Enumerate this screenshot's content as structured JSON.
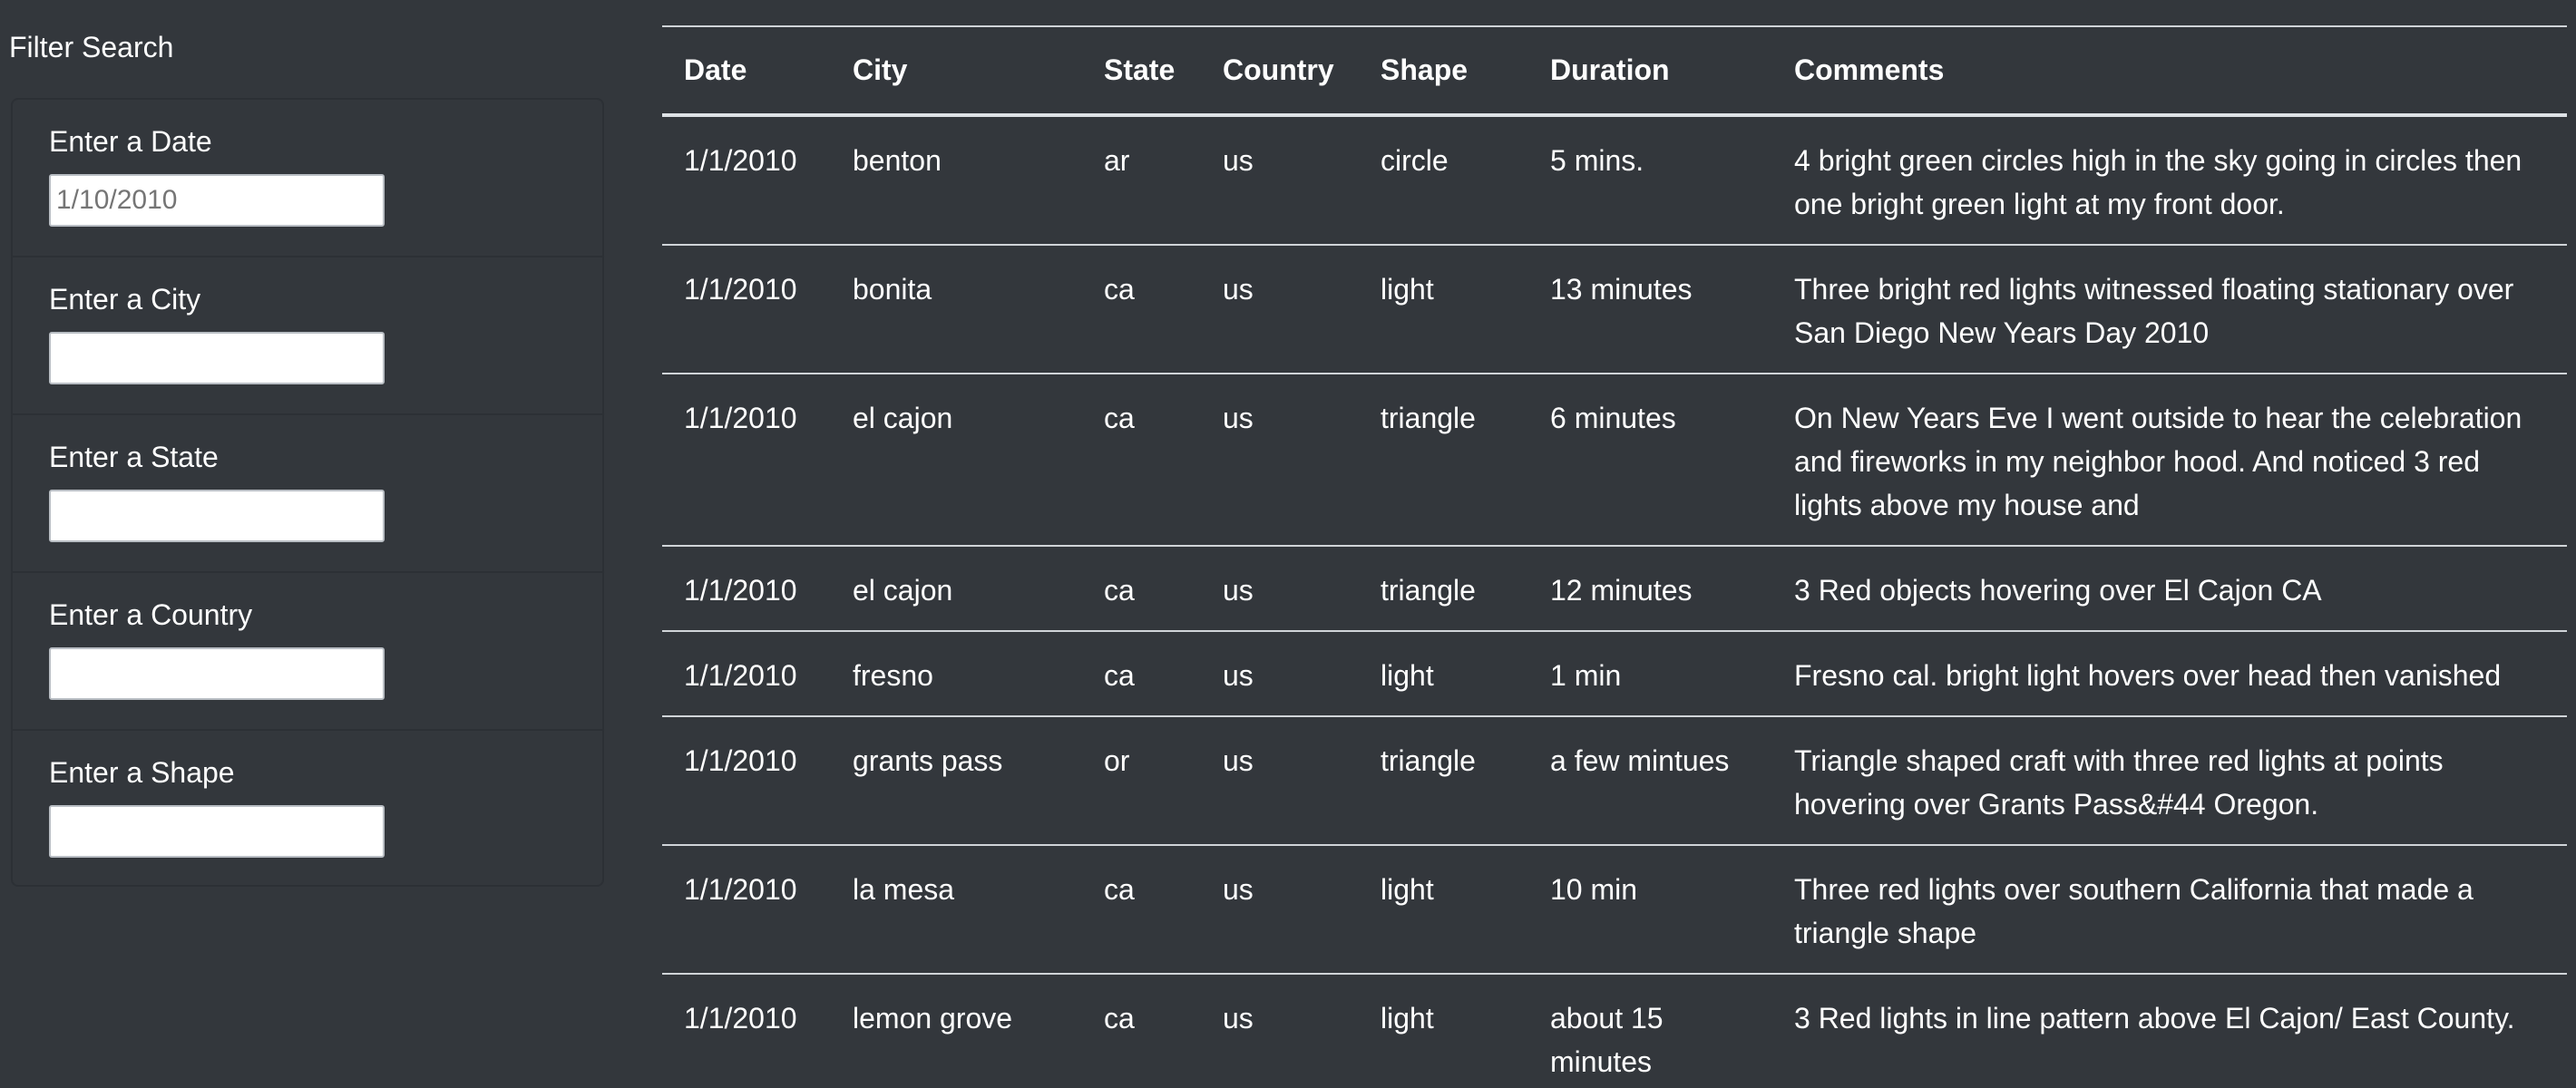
{
  "filter": {
    "title": "Filter Search",
    "fields": [
      {
        "label": "Enter a Date",
        "placeholder": "1/10/2010"
      },
      {
        "label": "Enter a City",
        "placeholder": ""
      },
      {
        "label": "Enter a State",
        "placeholder": ""
      },
      {
        "label": "Enter a Country",
        "placeholder": ""
      },
      {
        "label": "Enter a Shape",
        "placeholder": ""
      }
    ]
  },
  "table": {
    "headers": [
      "Date",
      "City",
      "State",
      "Country",
      "Shape",
      "Duration",
      "Comments"
    ],
    "rows": [
      [
        "1/1/2010",
        "benton",
        "ar",
        "us",
        "circle",
        "5 mins.",
        "4 bright green circles high in the sky going in circles then one bright green light at my front door."
      ],
      [
        "1/1/2010",
        "bonita",
        "ca",
        "us",
        "light",
        "13 minutes",
        "Three bright red lights witnessed floating stationary over San Diego New Years Day 2010"
      ],
      [
        "1/1/2010",
        "el cajon",
        "ca",
        "us",
        "triangle",
        "6 minutes",
        "On New Years Eve I went outside to hear the celebration and fireworks in my neighbor hood. And noticed 3 red lights above my house and"
      ],
      [
        "1/1/2010",
        "el cajon",
        "ca",
        "us",
        "triangle",
        "12 minutes",
        "3 Red objects hovering over El Cajon CA"
      ],
      [
        "1/1/2010",
        "fresno",
        "ca",
        "us",
        "light",
        "1 min",
        "Fresno cal. bright light hovers over head then vanished"
      ],
      [
        "1/1/2010",
        "grants pass",
        "or",
        "us",
        "triangle",
        "a few mintues",
        "Triangle shaped craft with three red lights at points hovering over Grants Pass&#44 Oregon."
      ],
      [
        "1/1/2010",
        "la mesa",
        "ca",
        "us",
        "light",
        "10 min",
        "Three red lights over southern California that made a triangle shape"
      ],
      [
        "1/1/2010",
        "lemon grove",
        "ca",
        "us",
        "light",
        "about 15 minutes",
        "3 Red lights in line pattern above El Cajon/ East County."
      ]
    ]
  }
}
